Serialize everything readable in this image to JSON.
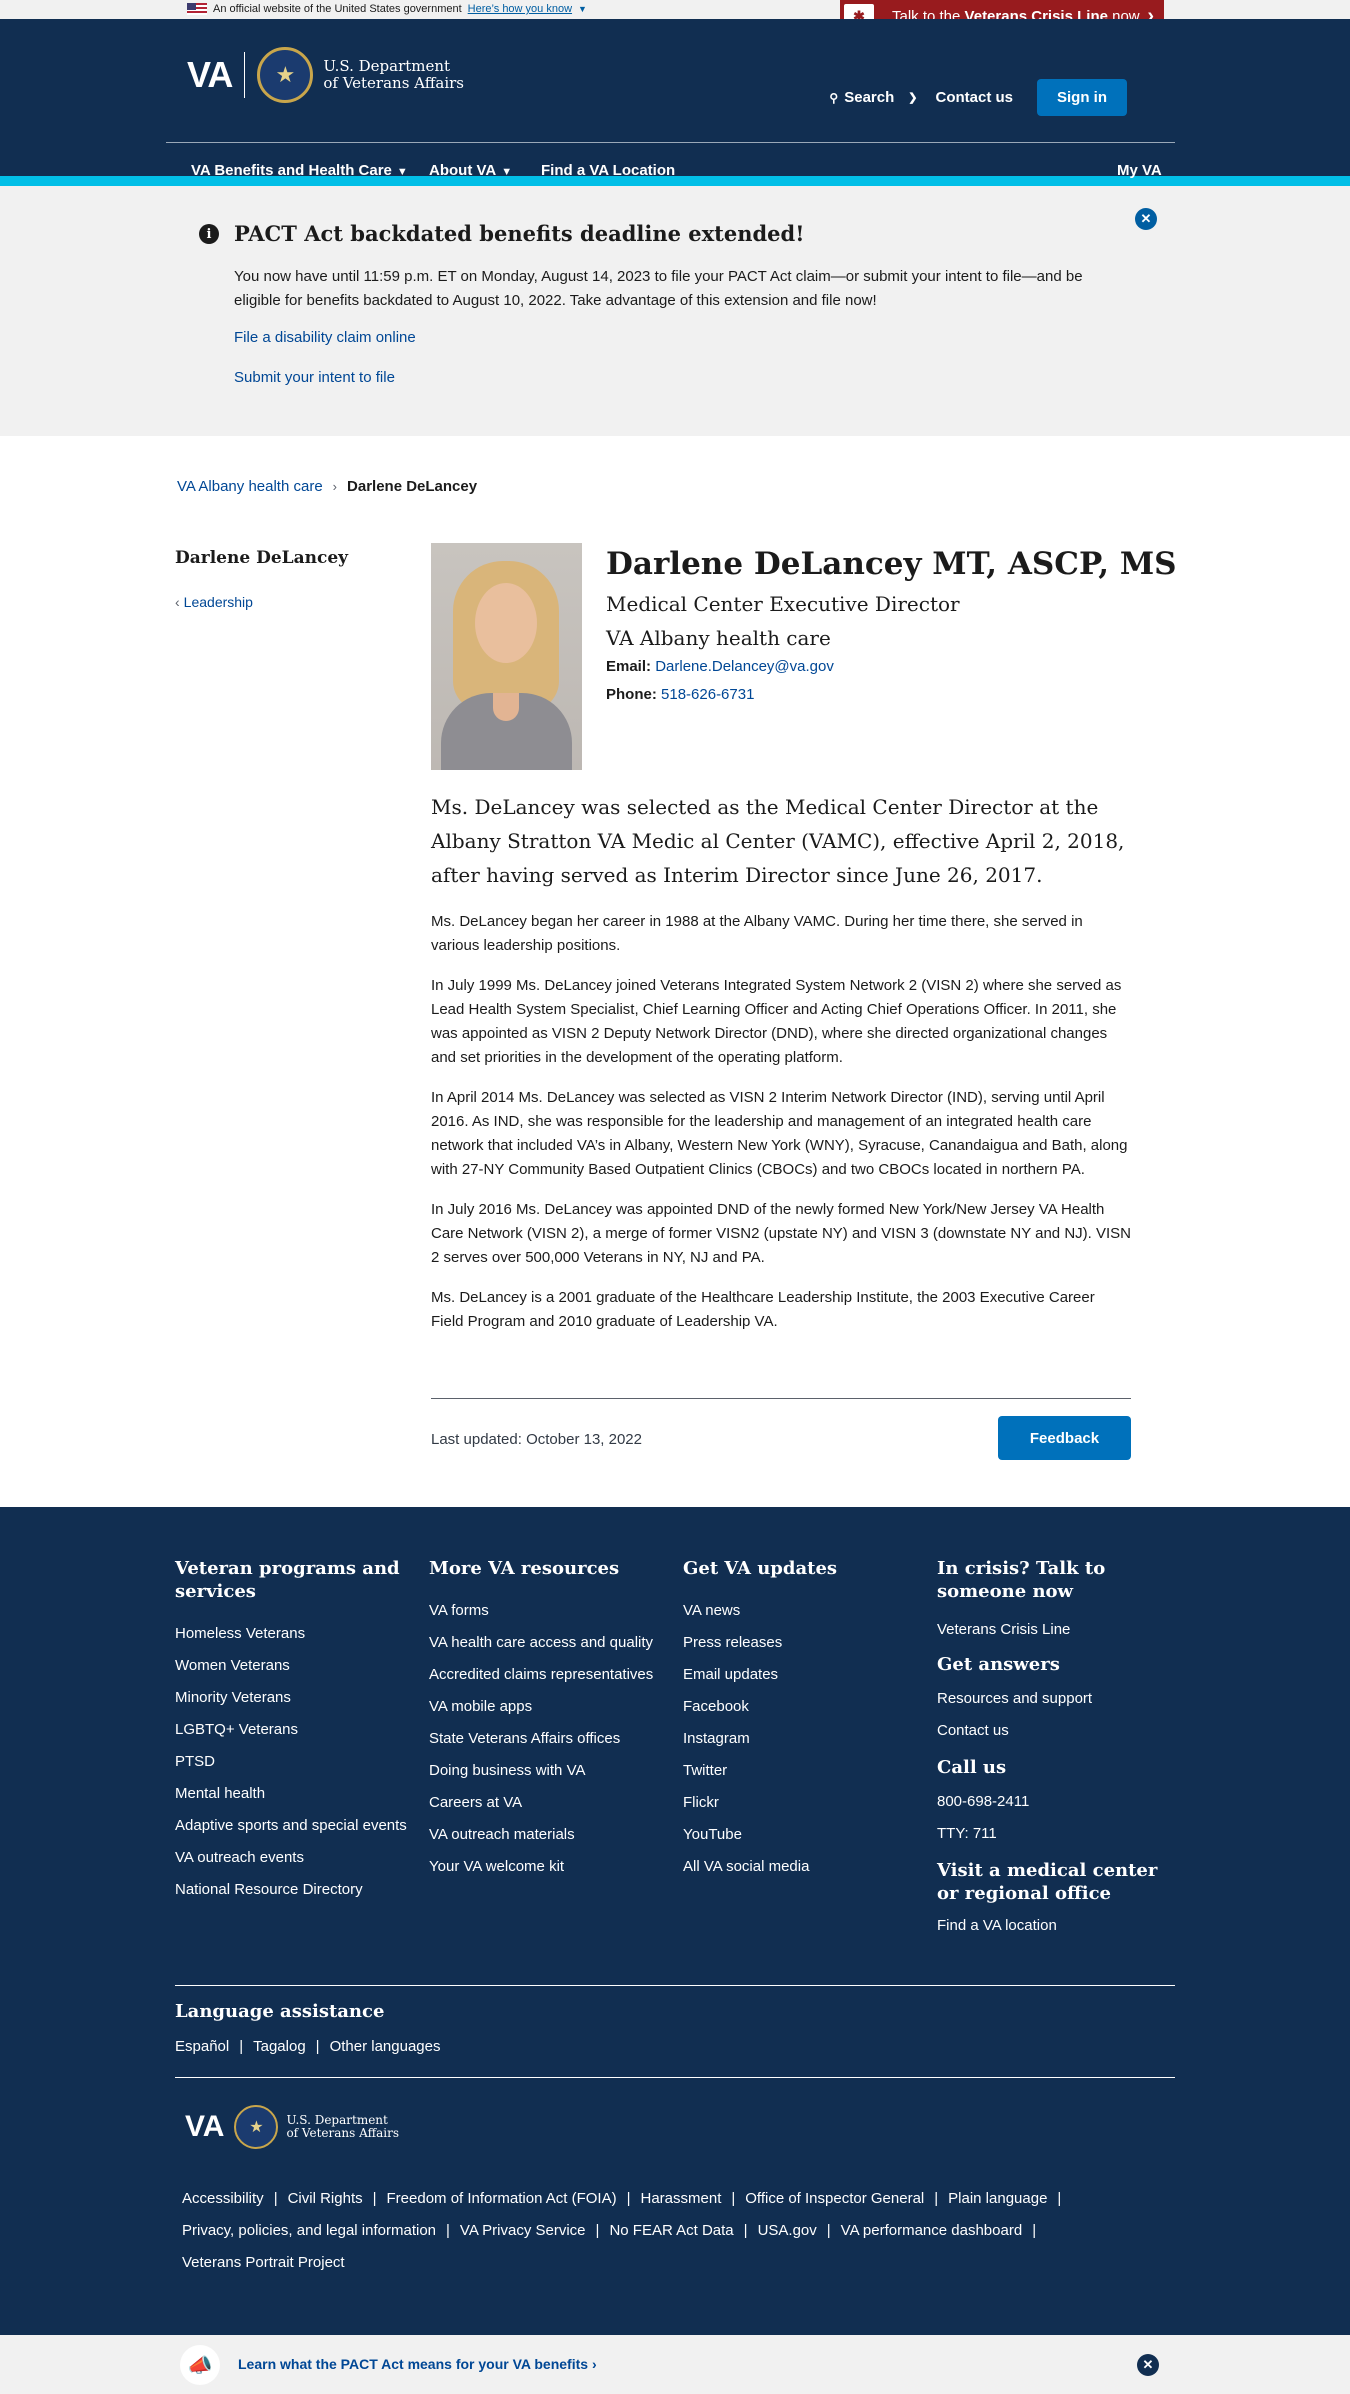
{
  "official_banner": {
    "text": "An official website of the United States government",
    "link": "Here’s how you know"
  },
  "crisis_line": {
    "prefix": "Talk to the ",
    "bold": "Veterans Crisis Line",
    "suffix": " now"
  },
  "header": {
    "logo_text": "VA",
    "dept_line1": "U.S. Department",
    "dept_line2": "of Veterans Affairs",
    "search": "Search",
    "contact": "Contact us",
    "signin": "Sign in"
  },
  "nav": {
    "items": [
      "VA Benefits and Health Care",
      "About VA",
      "Find a VA Location",
      "My VA"
    ]
  },
  "alert": {
    "title": "PACT Act backdated benefits deadline extended!",
    "body": "You now have until 11:59 p.m. ET on Monday, August 14, 2023 to file your PACT Act claim—or submit your intent to file—and be eligible for benefits backdated to August 10, 2022. Take advantage of this extension and file now!",
    "link1": "File a disability claim online",
    "link2": "Submit your intent to file"
  },
  "breadcrumb": {
    "parent": "VA Albany health care",
    "current": "Darlene DeLancey"
  },
  "sidebar": {
    "name": "Darlene DeLancey",
    "link": "Leadership"
  },
  "profile": {
    "name": "Darlene DeLancey MT, ASCP, MS",
    "title": "Medical Center Executive Director",
    "facility": "VA Albany health care",
    "email_label": "Email:",
    "email": "Darlene.Delancey@va.gov",
    "phone_label": "Phone:",
    "phone": "518-626-6731"
  },
  "content": {
    "lede": "Ms. DeLancey was selected as the Medical Center Director at the Albany Stratton VA Medic al Center (VAMC), effective April 2, 2018, after having served as Interim Director since June 26, 2017.",
    "paragraphs": [
      "Ms. DeLancey began her career in 1988 at the Albany VAMC. During her time there, she served in various leadership positions.",
      "In July 1999 Ms. DeLancey joined Veterans Integrated System Network 2 (VISN 2) where she served as Lead Health System Specialist, Chief Learning Officer and Acting Chief Operations Officer. In 2011, she was appointed as VISN 2 Deputy Network Director (DND), where she directed organizational changes and set priorities in the development of the operating platform.",
      "In April 2014 Ms. DeLancey was selected as VISN 2 Interim Network Director (IND), serving until April 2016. As IND, she was responsible for the leadership and management of an integrated health care network that included VA’s in Albany, Western New York (WNY), Syracuse, Canandaigua and Bath, along with 27-NY Community Based Outpatient Clinics (CBOCs) and two CBOCs located in northern PA.",
      "In July 2016 Ms. DeLancey was appointed DND of the newly formed New York/New Jersey VA Health Care Network (VISN 2), a merge of former VISN2 (upstate NY) and VISN 3 (downstate NY and NJ). VISN 2 serves over 500,000 Veterans in NY, NJ and PA.",
      "Ms. DeLancey is a 2001 graduate of the Healthcare Leadership Institute, the 2003 Executive Career Field Program and 2010 graduate of Leadership VA."
    ],
    "last_updated": "Last updated: October 13, 2022",
    "feedback": "Feedback"
  },
  "footer": {
    "col1": {
      "heading": "Veteran programs and services",
      "links": [
        "Homeless Veterans",
        "Women Veterans",
        "Minority Veterans",
        "LGBTQ+ Veterans",
        "PTSD",
        "Mental health",
        "Adaptive sports and special events",
        "VA outreach events",
        "National Resource Directory"
      ]
    },
    "col2": {
      "heading": "More VA resources",
      "links": [
        "VA forms",
        "VA health care access and quality",
        "Accredited claims representatives",
        "VA mobile apps",
        "State Veterans Affairs offices",
        "Doing business with VA",
        "Careers at VA",
        "VA outreach materials",
        "Your VA welcome kit"
      ]
    },
    "col3": {
      "heading": "Get VA updates",
      "links": [
        "VA news",
        "Press releases",
        "Email updates",
        "Facebook",
        "Instagram",
        "Twitter",
        "Flickr",
        "YouTube",
        "All VA social media"
      ]
    },
    "col4": {
      "crisis_heading": "In crisis? Talk to someone now",
      "crisis_link": "Veterans Crisis Line",
      "answers_heading": "Get answers",
      "answers_links": [
        "Resources and support",
        "Contact us"
      ],
      "call_heading": "Call us",
      "call_links": [
        "800-698-2411",
        "TTY: 711"
      ],
      "visit_heading": "Visit a medical center or regional office",
      "visit_link": "Find a VA location"
    },
    "language": {
      "heading": "Language assistance",
      "links": [
        "Español",
        "Tagalog",
        "Other languages"
      ]
    },
    "logo_text": "VA",
    "dept_line1": "U.S. Department",
    "dept_line2": "of Veterans Affairs",
    "legal_links": [
      "Accessibility",
      "Civil Rights",
      "Freedom of Information Act (FOIA)",
      "Harassment",
      "Office of Inspector General",
      "Plain language",
      "Privacy, policies, and legal information",
      "VA Privacy Service",
      "No FEAR Act Data",
      "USA.gov",
      "VA performance dashboard",
      "Veterans Portrait Project"
    ]
  },
  "bottom_banner": {
    "text": "Learn what the PACT Act means for your VA benefits"
  },
  "colors": {
    "navy": "#112e51",
    "primary": "#0071bb",
    "accent": "#02bfe7",
    "crisis": "#981b1e",
    "link": "#004795"
  }
}
